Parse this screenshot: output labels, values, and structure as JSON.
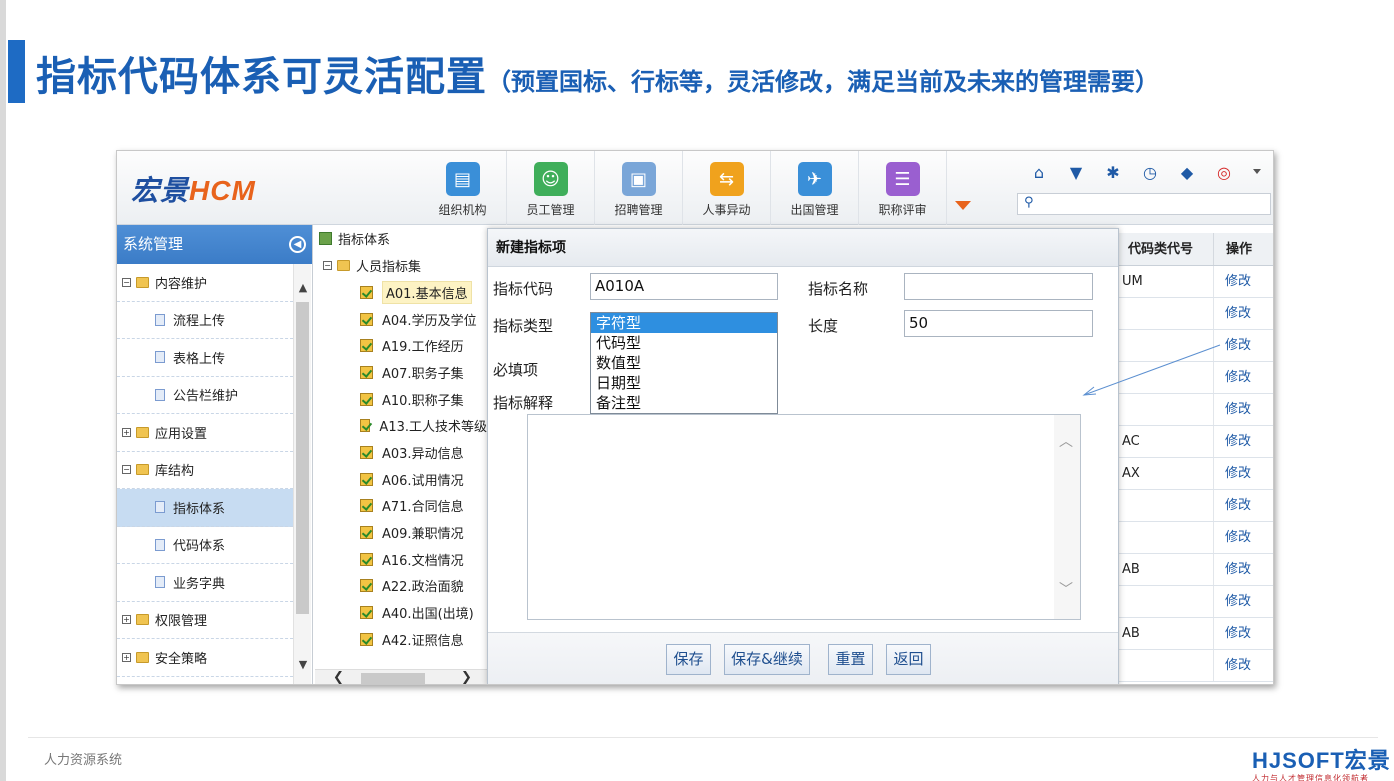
{
  "slide": {
    "title": "指标代码体系可灵活配置",
    "subtitle": "（预置国标、行标等，灵活修改，满足当前及未来的管理需要）",
    "footer_text": "人力资源系统",
    "brand_main": "HJSOFT宏景",
    "brand_tag": "人力与人才管理信息化领航者"
  },
  "app": {
    "logo_cn": "宏景",
    "logo_en": "HCM",
    "nav": [
      {
        "label": "组织机构",
        "icon": "org-chart-icon",
        "color": "#3a8fd8"
      },
      {
        "label": "员工管理",
        "icon": "employees-icon",
        "color": "#3fae5a"
      },
      {
        "label": "招聘管理",
        "icon": "recruit-icon",
        "color": "#7aa6d8"
      },
      {
        "label": "人事异动",
        "icon": "transfer-icon",
        "color": "#f0a21d"
      },
      {
        "label": "出国管理",
        "icon": "plane-icon",
        "color": "#3a8fd8"
      },
      {
        "label": "职称评审",
        "icon": "list-icon",
        "color": "#9a5fd0"
      }
    ],
    "tools": [
      "home-icon",
      "shirt-icon",
      "gear-icon",
      "clock-icon",
      "tag-icon",
      "power-icon"
    ],
    "search_placeholder": ""
  },
  "sidebar": {
    "title": "系统管理",
    "items": [
      {
        "label": "内容维护",
        "kind": "folder",
        "toggle": "⊟"
      },
      {
        "label": "流程上传",
        "kind": "doc"
      },
      {
        "label": "表格上传",
        "kind": "doc"
      },
      {
        "label": "公告栏维护",
        "kind": "doc"
      },
      {
        "label": "应用设置",
        "kind": "folder",
        "toggle": "⊞"
      },
      {
        "label": "库结构",
        "kind": "folder",
        "toggle": "⊟"
      },
      {
        "label": "指标体系",
        "kind": "doc",
        "active": true
      },
      {
        "label": "代码体系",
        "kind": "doc"
      },
      {
        "label": "业务字典",
        "kind": "doc"
      },
      {
        "label": "权限管理",
        "kind": "folder",
        "toggle": "⊞"
      },
      {
        "label": "安全策略",
        "kind": "folder",
        "toggle": "⊞"
      }
    ]
  },
  "tree": {
    "root": "指标体系",
    "group": "人员指标集",
    "items": [
      "A01.基本信息",
      "A04.学历及学位",
      "A19.工作经历",
      "A07.职务子集",
      "A10.职称子集",
      "A13.工人技术等级",
      "A03.异动信息",
      "A06.试用情况",
      "A71.合同信息",
      "A09.兼职情况",
      "A16.文档情况",
      "A22.政治面貌",
      "A40.出国(出境)",
      "A42.证照信息"
    ]
  },
  "table": {
    "col_code": "代码类代号",
    "col_op": "操作",
    "rows": [
      {
        "code": "UM",
        "op": "修改"
      },
      {
        "code": "",
        "op": "修改"
      },
      {
        "code": "",
        "op": "修改"
      },
      {
        "code": "",
        "op": "修改"
      },
      {
        "code": "",
        "op": "修改"
      },
      {
        "code": "AC",
        "op": "修改"
      },
      {
        "code": "AX",
        "op": "修改"
      },
      {
        "code": "",
        "op": "修改"
      },
      {
        "code": "",
        "op": "修改"
      },
      {
        "code": "AB",
        "op": "修改"
      },
      {
        "code": "",
        "op": "修改"
      },
      {
        "code": "AB",
        "op": "修改"
      },
      {
        "code": "",
        "op": "修改"
      }
    ]
  },
  "modal": {
    "title": "新建指标项",
    "code_label": "指标代码",
    "code_value": "A010A",
    "name_label": "指标名称",
    "name_value": "",
    "type_label": "指标类型",
    "type_options": [
      "字符型",
      "代码型",
      "数值型",
      "日期型",
      "备注型"
    ],
    "length_label": "长度",
    "length_value": "50",
    "required_label": "必填项",
    "desc_label": "指标解释",
    "buttons": {
      "save": "保存",
      "save_continue": "保存&继续",
      "reset": "重置",
      "back": "返回"
    }
  }
}
